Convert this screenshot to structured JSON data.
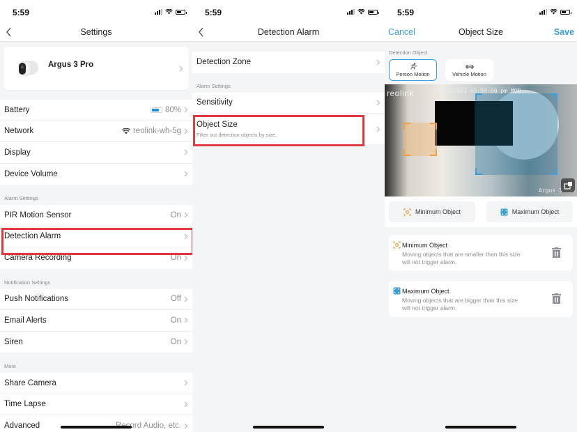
{
  "status_bar": {
    "time": "5:59"
  },
  "panel_settings": {
    "title": "Settings",
    "device": {
      "name": "Argus 3 Pro"
    },
    "group1": [
      {
        "label": "Battery",
        "value": "80%",
        "icon": "battery-icon",
        "battery_level_pct": 80
      },
      {
        "label": "Network",
        "value": "reolink-wh-5g",
        "icon": "wifi-icon"
      },
      {
        "label": "Display",
        "value": ""
      },
      {
        "label": "Device Volume",
        "value": ""
      }
    ],
    "alarm_section": "Alarm Settings",
    "group2": [
      {
        "label": "PIR Motion Sensor",
        "value": "On"
      },
      {
        "label": "Detection Alarm",
        "value": "",
        "highlighted": true
      },
      {
        "label": "Camera Recording",
        "value": "On"
      }
    ],
    "notification_section": "Notification Settings",
    "group3": [
      {
        "label": "Push Notifications",
        "value": "Off"
      },
      {
        "label": "Email Alerts",
        "value": "On"
      },
      {
        "label": "Siren",
        "value": "On"
      }
    ],
    "more_section": "More",
    "group4": [
      {
        "label": "Share Camera",
        "value": ""
      },
      {
        "label": "Time Lapse",
        "value": ""
      },
      {
        "label": "Advanced",
        "value": "Record Audio, etc."
      }
    ]
  },
  "panel_detection": {
    "title": "Detection Alarm",
    "zone": {
      "label": "Detection Zone"
    },
    "alarm_section": "Alarm Settings",
    "sensitivity": {
      "label": "Sensitivity"
    },
    "object_size": {
      "label": "Object Size",
      "subtitle": "Filter out detection objects by size.",
      "highlighted": true
    }
  },
  "panel_object": {
    "cancel": "Cancel",
    "title": "Object Size",
    "save": "Save",
    "detection_object_label": "Detection Object",
    "object_types": [
      {
        "label": "Person Motion",
        "icon": "person-running-icon",
        "selected": true
      },
      {
        "label": "Vehicle Motion",
        "icon": "car-icon",
        "selected": false
      }
    ],
    "preview": {
      "brand": "reolink",
      "timestamp": "08/22/2022 05:59:00 pm MON",
      "camera_label": "Argus 3 Pro"
    },
    "size_buttons": {
      "min": "Minimum Object",
      "max": "Maximum Object"
    },
    "cards": [
      {
        "title": "Minimum Object",
        "desc": "Moving objects that are smaller than this size will not trigger alarm."
      },
      {
        "title": "Maximum Object",
        "desc": "Moving objects that are bigger than this size will not trigger alarm."
      }
    ]
  },
  "colors": {
    "accent": "#3aa0dc",
    "highlight": "#e03a3e",
    "min_object": "#f0a040",
    "max_object": "#3aa0dc"
  }
}
